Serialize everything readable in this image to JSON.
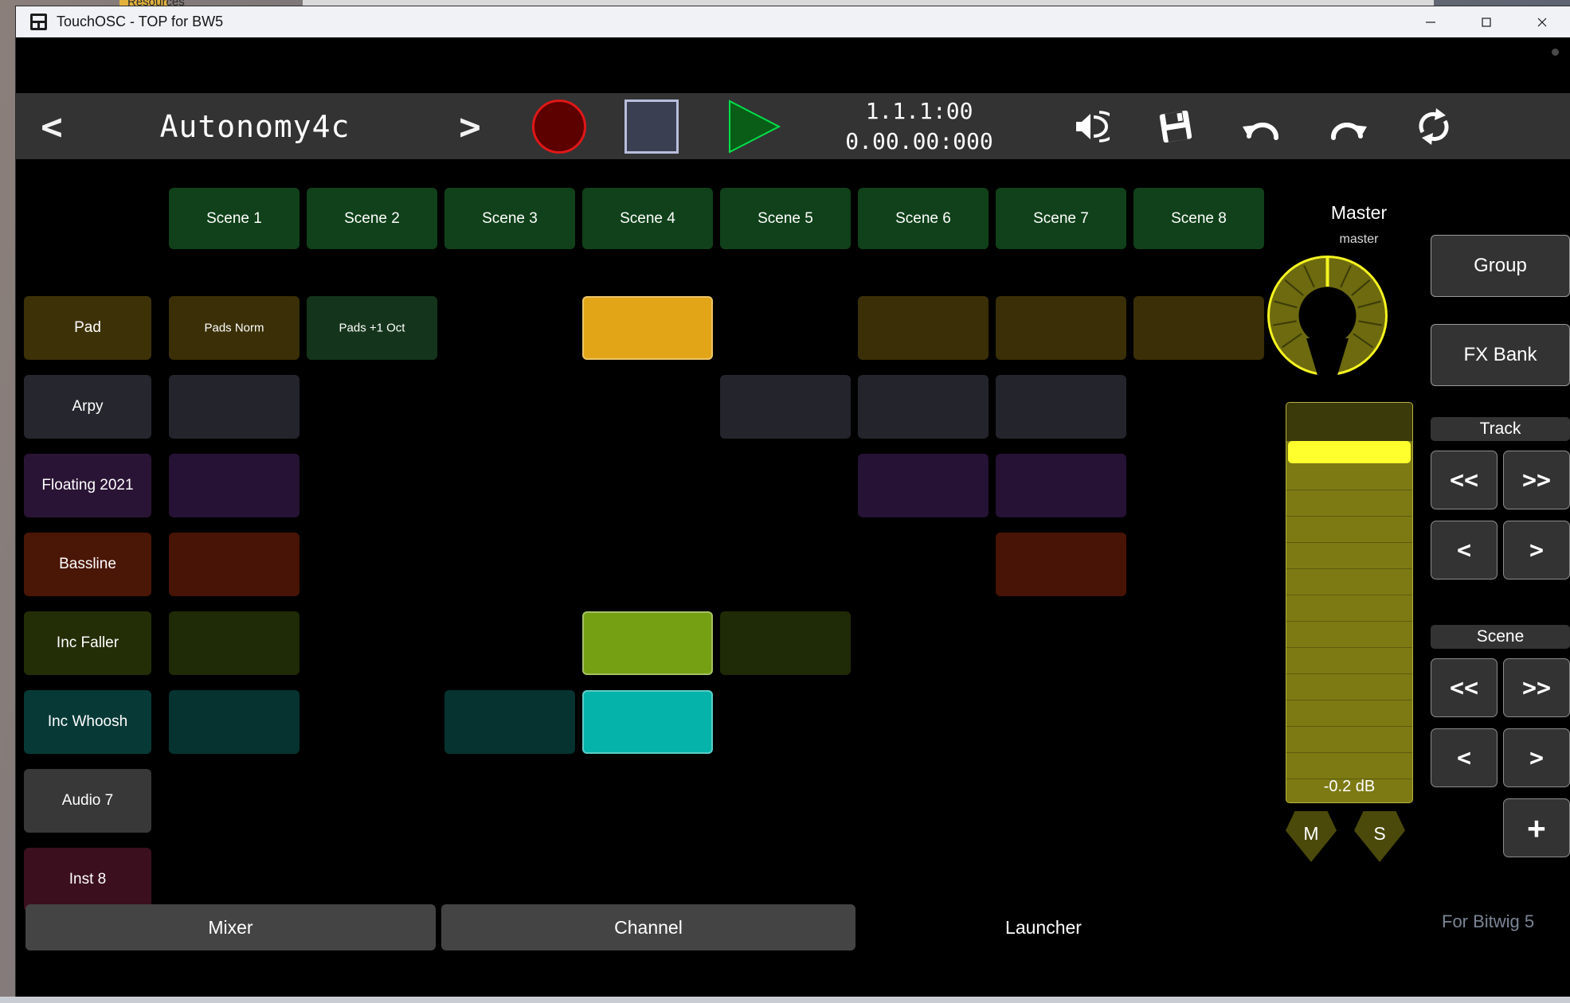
{
  "window": {
    "title": "TouchOSC - TOP for BW5",
    "minimize": "—",
    "maximize": "□",
    "close": "✕",
    "icon": "app-icon"
  },
  "desktop": {
    "folder_label": "Resources"
  },
  "transport": {
    "back_label": "<",
    "project_name": "Autonomy4c",
    "forward_label": ">",
    "record_label": "record",
    "stop_label": "stop",
    "play_label": "play",
    "time_primary": "1.1.1:00",
    "time_secondary": "0.00.00:000",
    "icons": [
      {
        "name": "metronome-icon",
        "label": "Metronome"
      },
      {
        "name": "save-icon",
        "label": "Save"
      },
      {
        "name": "undo-icon",
        "label": "Undo"
      },
      {
        "name": "redo-icon",
        "label": "Redo"
      },
      {
        "name": "loop-icon",
        "label": "Loop"
      }
    ]
  },
  "launcher": {
    "scenes": [
      {
        "label": "Scene 1"
      },
      {
        "label": "Scene 2"
      },
      {
        "label": "Scene 3"
      },
      {
        "label": "Scene 4"
      },
      {
        "label": "Scene 5"
      },
      {
        "label": "Scene 6"
      },
      {
        "label": "Scene 7"
      },
      {
        "label": "Scene 8"
      }
    ],
    "tracks": [
      {
        "label": "Pad",
        "color": "#3d3207"
      },
      {
        "label": "Arpy",
        "color": "#26262f"
      },
      {
        "label": "Floating 2021",
        "color": "#2a1435"
      },
      {
        "label": "Bassline",
        "color": "#4a1606"
      },
      {
        "label": "Inc Faller",
        "color": "#232e07"
      },
      {
        "label": "Inc Whoosh",
        "color": "#073a37"
      },
      {
        "label": "Audio 7",
        "color": "#383838"
      },
      {
        "label": "Inst 8",
        "color": "#3b0f1e"
      }
    ],
    "clips": [
      {
        "track": 0,
        "scene": 0,
        "label": "Pads Norm",
        "color": "#3a2f06",
        "playing": false
      },
      {
        "track": 0,
        "scene": 1,
        "label": "Pads +1 Oct",
        "color": "#14351b",
        "playing": false
      },
      {
        "track": 0,
        "scene": 3,
        "label": "",
        "color": "#e2a517",
        "playing": true
      },
      {
        "track": 0,
        "scene": 5,
        "label": "",
        "color": "#3a2f06",
        "playing": false
      },
      {
        "track": 0,
        "scene": 6,
        "label": "",
        "color": "#3a2f06",
        "playing": false
      },
      {
        "track": 0,
        "scene": 7,
        "label": "",
        "color": "#3a2f06",
        "playing": false
      },
      {
        "track": 1,
        "scene": 0,
        "label": "",
        "color": "#24242d",
        "playing": false
      },
      {
        "track": 1,
        "scene": 4,
        "label": "",
        "color": "#24242d",
        "playing": false
      },
      {
        "track": 1,
        "scene": 5,
        "label": "",
        "color": "#24242d",
        "playing": false
      },
      {
        "track": 1,
        "scene": 6,
        "label": "",
        "color": "#24242d",
        "playing": false
      },
      {
        "track": 2,
        "scene": 0,
        "label": "",
        "color": "#261235",
        "playing": false
      },
      {
        "track": 2,
        "scene": 5,
        "label": "",
        "color": "#261235",
        "playing": false
      },
      {
        "track": 2,
        "scene": 6,
        "label": "",
        "color": "#261235",
        "playing": false
      },
      {
        "track": 3,
        "scene": 0,
        "label": "",
        "color": "#481405",
        "playing": false
      },
      {
        "track": 3,
        "scene": 6,
        "label": "",
        "color": "#481405",
        "playing": false
      },
      {
        "track": 4,
        "scene": 0,
        "label": "",
        "color": "#1f2a06",
        "playing": false
      },
      {
        "track": 4,
        "scene": 3,
        "label": "",
        "color": "#76a013",
        "playing": true
      },
      {
        "track": 4,
        "scene": 4,
        "label": "",
        "color": "#1f2a06",
        "playing": false
      },
      {
        "track": 5,
        "scene": 0,
        "label": "",
        "color": "#06332f",
        "playing": false
      },
      {
        "track": 5,
        "scene": 2,
        "label": "",
        "color": "#06332f",
        "playing": false
      },
      {
        "track": 5,
        "scene": 3,
        "label": "",
        "color": "#06b3aa",
        "playing": true
      }
    ]
  },
  "master": {
    "title": "Master",
    "subtitle": "master",
    "knob_name": "master-pan-knob",
    "fader_value": "-0.2 dB",
    "mute_label": "M",
    "solo_label": "S"
  },
  "right_panel": {
    "group_label": "Group",
    "fx_bank_label": "FX Bank",
    "track_section_label": "Track",
    "scene_section_label": "Scene",
    "nav": {
      "prev_bank": "<<",
      "next_bank": ">>",
      "prev": "<",
      "next": ">"
    },
    "add_label": "+"
  },
  "bottom": {
    "tabs": [
      {
        "label": "Mixer",
        "active": false
      },
      {
        "label": "Channel",
        "active": false
      },
      {
        "label": "Launcher",
        "active": true
      }
    ],
    "brand": "For Bitwig 5"
  }
}
